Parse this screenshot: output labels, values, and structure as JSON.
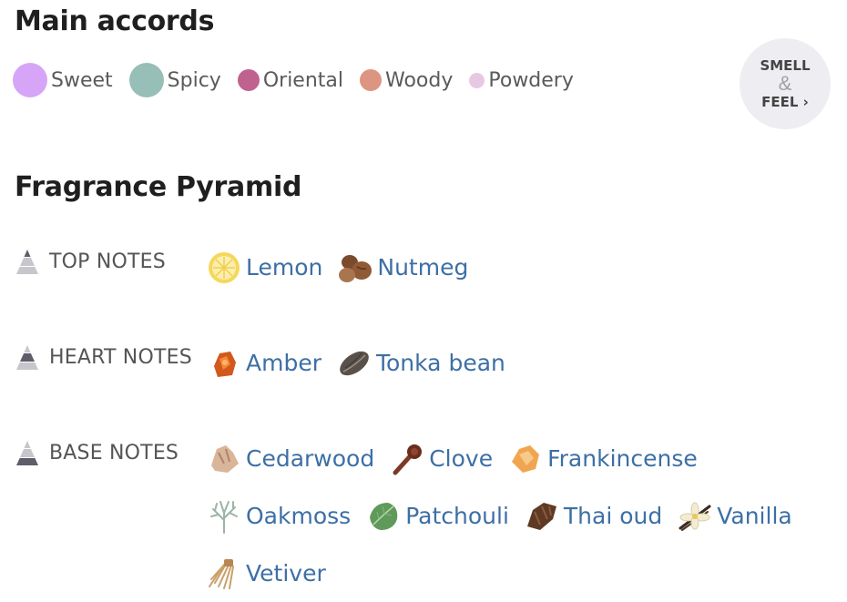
{
  "main_accords": {
    "title": "Main accords",
    "items": [
      {
        "label": "Sweet",
        "color": "#d6a5f7",
        "size": 38
      },
      {
        "label": "Spicy",
        "color": "#97beb7",
        "size": 38
      },
      {
        "label": "Oriental",
        "color": "#c0628f",
        "size": 24
      },
      {
        "label": "Woody",
        "color": "#dc9580",
        "size": 24
      },
      {
        "label": "Powdery",
        "color": "#e7c8e2",
        "size": 17
      }
    ]
  },
  "smell_feel": {
    "line1": "SMELL",
    "amp": "&",
    "line2": "FEEL ›"
  },
  "pyramid": {
    "title": "Fragrance Pyramid",
    "top": {
      "label": "TOP NOTES",
      "notes": [
        "Lemon",
        "Nutmeg"
      ]
    },
    "heart": {
      "label": "HEART NOTES",
      "notes": [
        "Amber",
        "Tonka bean"
      ]
    },
    "base": {
      "label": "BASE NOTES",
      "notes": [
        "Cedarwood",
        "Clove",
        "Frankincense",
        "Oakmoss",
        "Patchouli",
        "Thai oud",
        "Vanilla",
        "Vetiver"
      ]
    }
  }
}
